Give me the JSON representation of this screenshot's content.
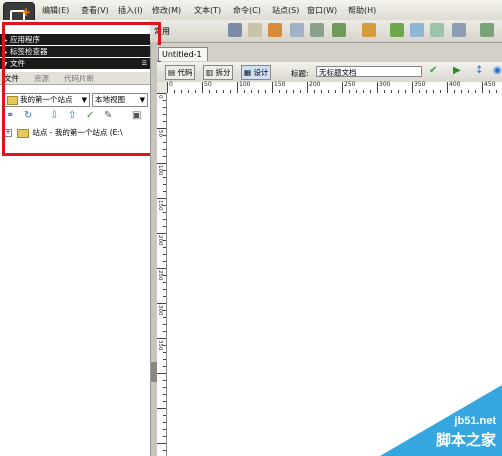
{
  "menu": [
    "编辑(E)",
    "查看(V)",
    "插入(I)",
    "修改(M)",
    "文本(T)",
    "命令(C)",
    "站点(S)",
    "窗口(W)",
    "帮助(H)"
  ],
  "insert_bar": {
    "label": "常用"
  },
  "panels": {
    "app": "应用程序",
    "tag_inspector": "标签检查器",
    "files": "文件"
  },
  "files_tabs": [
    "文件",
    "资源",
    "代码片断"
  ],
  "site_select": "我的第一个站点",
  "view_select": "本地视图",
  "tree": {
    "label": "站点 - 我的第一个站点 (E:\\"
  },
  "document": {
    "tab": "Untitled-1",
    "view_buttons": [
      "代码",
      "拆分",
      "设计"
    ],
    "title_label": "标题:",
    "title_value": "无标题文档"
  },
  "ruler": {
    "h_labels": [
      "0",
      "50",
      "100",
      "150",
      "200",
      "250",
      "300",
      "350",
      "400",
      "450"
    ],
    "v_labels": [
      "0",
      "50",
      "100",
      "150",
      "200",
      "250",
      "300",
      "350"
    ]
  },
  "watermark": {
    "line1": "jb51.net",
    "line2": "脚本之家"
  },
  "colors": {
    "highlight": "#e0121b",
    "watermark_bg": "#35a6e0",
    "accent": "#ff7a00"
  },
  "icons": [
    "app-logo-icon",
    "refresh-icon",
    "connect-icon",
    "get-icon",
    "put-icon",
    "checkout-icon",
    "checkin-icon",
    "expand-icon",
    "folder-icon"
  ]
}
